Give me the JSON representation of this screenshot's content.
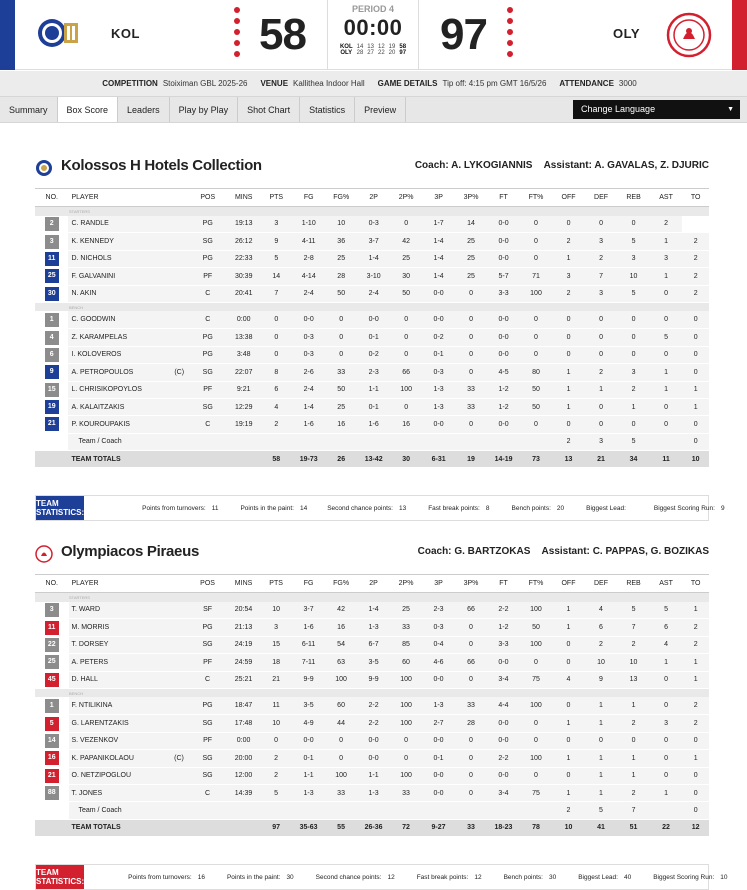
{
  "home": {
    "code": "KOL",
    "score": "58",
    "color": "#1e3f98",
    "logo_text": "KOLOSSOS"
  },
  "away": {
    "code": "OLY",
    "score": "97",
    "color": "#d3202f",
    "logo_text": "OLYMPIACOS"
  },
  "period": "PERIOD 4",
  "clock": "00:00",
  "quarters": {
    "home": {
      "code": "KOL",
      "q": [
        "14",
        "13",
        "12",
        "19"
      ],
      "total": "58"
    },
    "away": {
      "code": "OLY",
      "q": [
        "28",
        "27",
        "22",
        "20"
      ],
      "total": "97"
    }
  },
  "info": {
    "competition_label": "COMPETITION",
    "competition": "Stoiximan GBL 2025-26",
    "venue_label": "VENUE",
    "venue": "Kallithea Indoor Hall",
    "details_label": "GAME DETAILS",
    "details": "Tip off: 4:15 pm GMT 16/5/26",
    "attendance_label": "ATTENDANCE",
    "attendance": "3000"
  },
  "tabs": [
    "Summary",
    "Box Score",
    "Leaders",
    "Play by Play",
    "Shot Chart",
    "Statistics",
    "Preview"
  ],
  "active_tab": "Box Score",
  "language": "Change Language",
  "columns": [
    "NO.",
    "PLAYER",
    "POS",
    "MINS",
    "PTS",
    "FG",
    "FG%",
    "2P",
    "2P%",
    "3P",
    "3P%",
    "FT",
    "FT%",
    "OFF",
    "DEF",
    "REB",
    "AST",
    "TO"
  ],
  "starters_label": "STARTERS",
  "bench_label": "BENCH",
  "teams": [
    {
      "name": "Kolossos H Hotels Collection",
      "coach_label": "Coach:",
      "coach": "A. LYKOGIANNIS",
      "assistant_label": "Assistant:",
      "assistant": "A. GAVALAS, Z. DJURIC",
      "color": "#1e3f98",
      "num_color": "#8c8c8c",
      "starters": [
        [
          "2",
          "C. RANDLE",
          "",
          "PG",
          "19:13",
          "3",
          "1-10",
          "10",
          "0-3",
          "0",
          "1-7",
          "14",
          "0-0",
          "0",
          "0",
          "0",
          "0",
          "2"
        ],
        [
          "3",
          "K. KENNEDY",
          "",
          "SG",
          "26:12",
          "9",
          "4-11",
          "36",
          "3-7",
          "42",
          "1-4",
          "25",
          "0-0",
          "0",
          "2",
          "3",
          "5",
          "1",
          "2"
        ],
        [
          "11",
          "D. NICHOLS",
          "",
          "PG",
          "22:33",
          "5",
          "2-8",
          "25",
          "1-4",
          "25",
          "1-4",
          "25",
          "0-0",
          "0",
          "1",
          "2",
          "3",
          "3",
          "2"
        ],
        [
          "25",
          "F. GALVANINI",
          "",
          "PF",
          "30:39",
          "14",
          "4-14",
          "28",
          "3-10",
          "30",
          "1-4",
          "25",
          "5-7",
          "71",
          "3",
          "7",
          "10",
          "1",
          "2"
        ],
        [
          "30",
          "N. AKIN",
          "",
          "C",
          "20:41",
          "7",
          "2-4",
          "50",
          "2-4",
          "50",
          "0-0",
          "0",
          "3-3",
          "100",
          "2",
          "3",
          "5",
          "0",
          "2"
        ]
      ],
      "bench": [
        [
          "1",
          "C. GOODWIN",
          "",
          "C",
          "0:00",
          "0",
          "0-0",
          "0",
          "0-0",
          "0",
          "0-0",
          "0",
          "0-0",
          "0",
          "0",
          "0",
          "0",
          "0",
          "0"
        ],
        [
          "4",
          "Z. KARAMPELAS",
          "",
          "PG",
          "13:38",
          "0",
          "0-3",
          "0",
          "0-1",
          "0",
          "0-2",
          "0",
          "0-0",
          "0",
          "0",
          "0",
          "0",
          "5",
          "0"
        ],
        [
          "6",
          "I. KOLOVEROS",
          "",
          "PG",
          "3:48",
          "0",
          "0-3",
          "0",
          "0-2",
          "0",
          "0-1",
          "0",
          "0-0",
          "0",
          "0",
          "0",
          "0",
          "0",
          "0"
        ],
        [
          "9",
          "A. PETROPOULOS",
          "(C)",
          "SG",
          "22:07",
          "8",
          "2-6",
          "33",
          "2-3",
          "66",
          "0-3",
          "0",
          "4-5",
          "80",
          "1",
          "2",
          "3",
          "1",
          "0"
        ],
        [
          "15",
          "L. CHRISIKOPOYLOS",
          "",
          "PF",
          "9:21",
          "6",
          "2-4",
          "50",
          "1-1",
          "100",
          "1-3",
          "33",
          "1-2",
          "50",
          "1",
          "1",
          "2",
          "1",
          "1"
        ],
        [
          "19",
          "A. KALAITZAKIS",
          "",
          "SG",
          "12:29",
          "4",
          "1-4",
          "25",
          "0-1",
          "0",
          "1-3",
          "33",
          "1-2",
          "50",
          "1",
          "0",
          "1",
          "0",
          "1"
        ],
        [
          "21",
          "P. KOUROUPAKIS",
          "",
          "C",
          "19:19",
          "2",
          "1-6",
          "16",
          "1-6",
          "16",
          "0-0",
          "0",
          "0-0",
          "0",
          "0",
          "0",
          "0",
          "0",
          "0"
        ]
      ],
      "team_coach": [
        "",
        "Team / Coach",
        "",
        "",
        "",
        "",
        "",
        "",
        "",
        "",
        "",
        "",
        "",
        "",
        "2",
        "3",
        "5",
        "",
        "0"
      ],
      "totals": [
        "",
        "TEAM TOTALS",
        "",
        "",
        "",
        "58",
        "19-73",
        "26",
        "13-42",
        "30",
        "6-31",
        "19",
        "14-19",
        "73",
        "13",
        "21",
        "34",
        "11",
        "10"
      ],
      "team_stats": [
        [
          "Points from turnovers:",
          "11"
        ],
        [
          "Points in the paint:",
          "14"
        ],
        [
          "Second chance points:",
          "13"
        ],
        [
          "Fast break points:",
          "8"
        ],
        [
          "Bench points:",
          "20"
        ],
        [
          "Biggest Lead:",
          ""
        ],
        [
          "Biggest Scoring Run:",
          "9"
        ]
      ]
    },
    {
      "name": "Olympiacos Piraeus",
      "coach_label": "Coach:",
      "coach": "G. BARTZOKAS",
      "assistant_label": "Assistant:",
      "assistant": "C. PAPPAS, G. BOZIKAS",
      "color": "#d3202f",
      "num_color": "#8c8c8c",
      "starters": [
        [
          "3",
          "T. WARD",
          "",
          "SF",
          "20:54",
          "10",
          "3-7",
          "42",
          "1-4",
          "25",
          "2-3",
          "66",
          "2-2",
          "100",
          "1",
          "4",
          "5",
          "5",
          "1"
        ],
        [
          "11",
          "M. MORRIS",
          "",
          "PG",
          "21:13",
          "3",
          "1-6",
          "16",
          "1-3",
          "33",
          "0-3",
          "0",
          "1-2",
          "50",
          "1",
          "6",
          "7",
          "6",
          "2"
        ],
        [
          "22",
          "T. DORSEY",
          "",
          "SG",
          "24:19",
          "15",
          "6-11",
          "54",
          "6-7",
          "85",
          "0-4",
          "0",
          "3-3",
          "100",
          "0",
          "2",
          "2",
          "4",
          "2"
        ],
        [
          "25",
          "A. PETERS",
          "",
          "PF",
          "24:59",
          "18",
          "7-11",
          "63",
          "3-5",
          "60",
          "4-6",
          "66",
          "0-0",
          "0",
          "0",
          "10",
          "10",
          "1",
          "1"
        ],
        [
          "45",
          "D. HALL",
          "",
          "C",
          "25:21",
          "21",
          "9-9",
          "100",
          "9-9",
          "100",
          "0-0",
          "0",
          "3-4",
          "75",
          "4",
          "9",
          "13",
          "0",
          "1"
        ]
      ],
      "bench": [
        [
          "1",
          "F. NTILIKINA",
          "",
          "PG",
          "18:47",
          "11",
          "3-5",
          "60",
          "2-2",
          "100",
          "1-3",
          "33",
          "4-4",
          "100",
          "0",
          "1",
          "1",
          "0",
          "2"
        ],
        [
          "5",
          "G. LARENTZAKIS",
          "",
          "SG",
          "17:48",
          "10",
          "4-9",
          "44",
          "2-2",
          "100",
          "2-7",
          "28",
          "0-0",
          "0",
          "1",
          "1",
          "2",
          "3",
          "2"
        ],
        [
          "14",
          "S. VEZENKOV",
          "",
          "PF",
          "0:00",
          "0",
          "0-0",
          "0",
          "0-0",
          "0",
          "0-0",
          "0",
          "0-0",
          "0",
          "0",
          "0",
          "0",
          "0",
          "0"
        ],
        [
          "16",
          "K. PAPANIKOLAOU",
          "(C)",
          "SG",
          "20:00",
          "2",
          "0-1",
          "0",
          "0-0",
          "0",
          "0-1",
          "0",
          "2-2",
          "100",
          "1",
          "1",
          "1",
          "0",
          "1"
        ],
        [
          "21",
          "O. NETZIPOGLOU",
          "",
          "SG",
          "12:00",
          "2",
          "1-1",
          "100",
          "1-1",
          "100",
          "0-0",
          "0",
          "0-0",
          "0",
          "0",
          "1",
          "1",
          "0",
          "0"
        ],
        [
          "88",
          "T. JONES",
          "",
          "C",
          "14:39",
          "5",
          "1-3",
          "33",
          "1-3",
          "33",
          "0-0",
          "0",
          "3-4",
          "75",
          "1",
          "1",
          "2",
          "1",
          "0"
        ]
      ],
      "team_coach": [
        "",
        "Team / Coach",
        "",
        "",
        "",
        "",
        "",
        "",
        "",
        "",
        "",
        "",
        "",
        "",
        "2",
        "5",
        "7",
        "",
        "0"
      ],
      "totals": [
        "",
        "TEAM TOTALS",
        "",
        "",
        "",
        "97",
        "35-63",
        "55",
        "26-36",
        "72",
        "9-27",
        "33",
        "18-23",
        "78",
        "10",
        "41",
        "51",
        "22",
        "12"
      ],
      "team_stats": [
        [
          "Points from turnovers:",
          "16"
        ],
        [
          "Points in the paint:",
          "30"
        ],
        [
          "Second chance points:",
          "12"
        ],
        [
          "Fast break points:",
          "12"
        ],
        [
          "Bench points:",
          "30"
        ],
        [
          "Biggest Lead:",
          "40"
        ],
        [
          "Biggest Scoring Run:",
          "10"
        ]
      ]
    }
  ],
  "team_stats_label": "TEAM STATISTICS:"
}
